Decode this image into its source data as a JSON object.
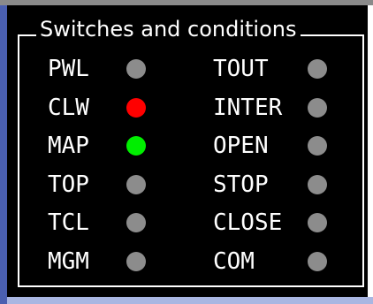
{
  "panel": {
    "title": "Switches and conditions"
  },
  "colors": {
    "led_off": "#8c8c8c",
    "led_red": "#ff0000",
    "led_green": "#00ee00"
  },
  "left_items": [
    {
      "label": "PWL",
      "state": "off"
    },
    {
      "label": "CLW",
      "state": "red"
    },
    {
      "label": "MAP",
      "state": "green"
    },
    {
      "label": "TOP",
      "state": "off"
    },
    {
      "label": "TCL",
      "state": "off"
    },
    {
      "label": "MGM",
      "state": "off"
    }
  ],
  "right_items": [
    {
      "label": "TOUT",
      "state": "off"
    },
    {
      "label": "INTER",
      "state": "off"
    },
    {
      "label": "OPEN",
      "state": "off"
    },
    {
      "label": "STOP",
      "state": "off"
    },
    {
      "label": "CLOSE",
      "state": "off"
    },
    {
      "label": "COM",
      "state": "off"
    }
  ]
}
